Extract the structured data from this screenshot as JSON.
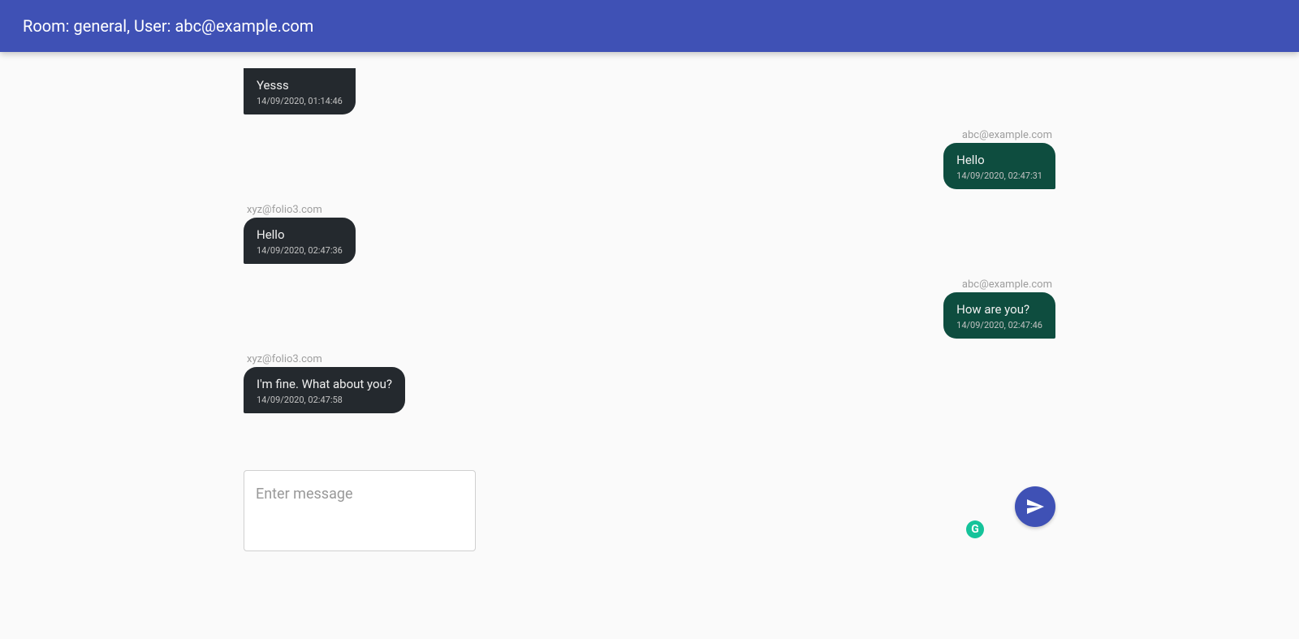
{
  "header": {
    "title": "Room: general, User: abc@example.com"
  },
  "messages": [
    {
      "side": "left",
      "sender": "",
      "text": "Yesss",
      "timestamp": "14/09/2020, 01:14:46",
      "partial_top": true
    },
    {
      "side": "right",
      "sender": "abc@example.com",
      "text": "Hello",
      "timestamp": "14/09/2020, 02:47:31"
    },
    {
      "side": "left",
      "sender": "xyz@folio3.com",
      "text": "Hello",
      "timestamp": "14/09/2020, 02:47:36"
    },
    {
      "side": "right",
      "sender": "abc@example.com",
      "text": "How are you?",
      "timestamp": "14/09/2020, 02:47:46"
    },
    {
      "side": "left",
      "sender": "xyz@folio3.com",
      "text": "I'm fine. What about you?",
      "timestamp": "14/09/2020, 02:47:58"
    }
  ],
  "composer": {
    "placeholder": "Enter message",
    "value": "",
    "grammarly_badge": "G"
  },
  "icons": {
    "send": "send-icon"
  }
}
